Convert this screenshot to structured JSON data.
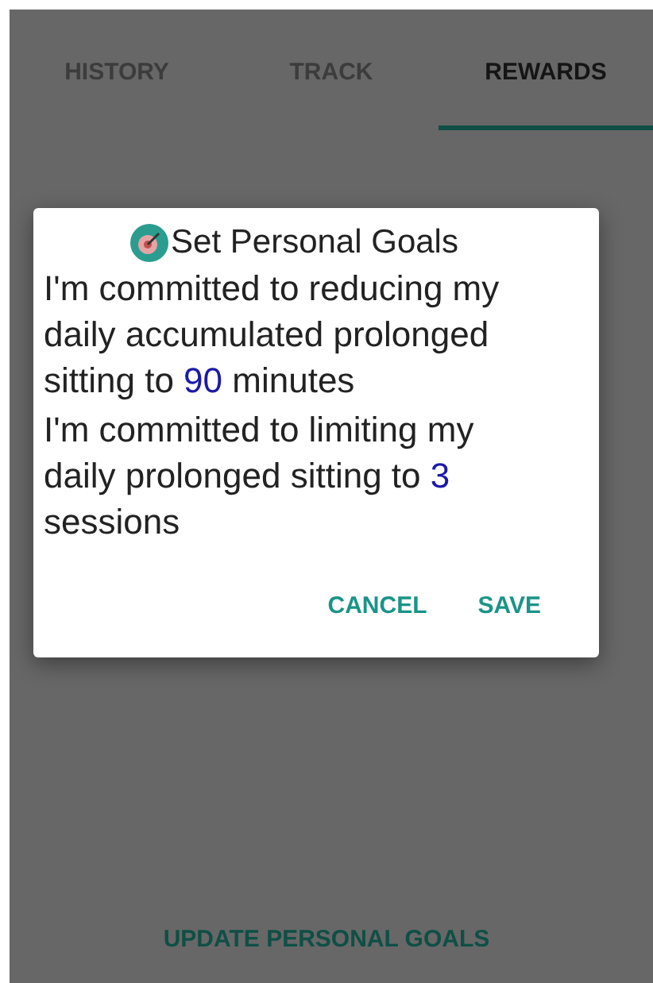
{
  "tabs": [
    {
      "label": "HISTORY",
      "selected": false
    },
    {
      "label": "TRACK",
      "selected": false
    },
    {
      "label": "REWARDS",
      "selected": true
    }
  ],
  "dialog": {
    "title": "Set Personal Goals",
    "goals": [
      {
        "before": "I'm committed to reducing my daily accumulated prolonged sitting to ",
        "value": "90",
        "after": " minutes"
      },
      {
        "before": "I'm committed to limiting my daily prolonged sitting to ",
        "value": "3",
        "after": " sessions"
      }
    ],
    "buttons": [
      "CANCEL",
      "SAVE"
    ]
  },
  "update_button": "UPDATE PERSONAL GOALS"
}
